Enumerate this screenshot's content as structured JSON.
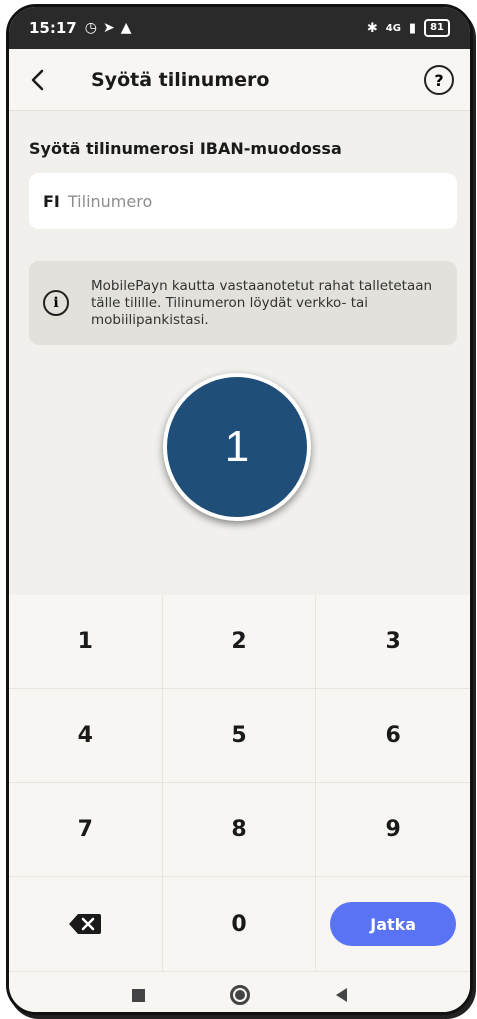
{
  "status_bar": {
    "time": "15:17",
    "alarm_icon": "alarm-icon",
    "location_icon": "navigation-arrow-icon",
    "alert_icon": "warning-triangle-icon",
    "network_label": "4G",
    "battery": "81"
  },
  "app_bar": {
    "title": "Syötä tilinumero",
    "back_icon": "chevron-left-icon",
    "help_label": "?"
  },
  "form": {
    "label": "Syötä tilinumerosi IBAN-muodossa",
    "prefix": "FI",
    "placeholder": "Tilinumero",
    "value": ""
  },
  "info": {
    "icon_label": "i",
    "text": "MobilePayn kautta vastaanotetut rahat talletetaan tälle tilille. Tilinumeron löydät verkko- tai mobiilipankistasi."
  },
  "step_badge": "1",
  "keypad": {
    "keys": [
      "1",
      "2",
      "3",
      "4",
      "5",
      "6",
      "7",
      "8",
      "9"
    ],
    "zero": "0",
    "backspace_icon": "backspace-icon",
    "continue_label": "Jatka"
  },
  "colors": {
    "accent": "#5a73f5",
    "badge": "#1f4e79",
    "background": "#f1f0ec"
  }
}
